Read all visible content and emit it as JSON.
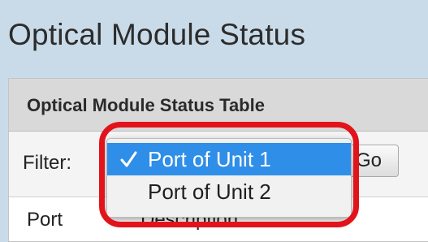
{
  "page": {
    "title": "Optical Module Status"
  },
  "table": {
    "title": "Optical Module Status Table",
    "filter_label": "Filter:",
    "go_label": "Go",
    "columns": [
      "Port",
      "Description"
    ]
  },
  "filter_menu": {
    "options": [
      {
        "label": "Port of Unit 1",
        "selected": true
      },
      {
        "label": "Port of Unit 2",
        "selected": false
      }
    ]
  },
  "colors": {
    "selection": "#2f8ee8",
    "highlight_ring": "#e2131b"
  },
  "icons": {
    "selected_marker": "checkmark-icon"
  }
}
